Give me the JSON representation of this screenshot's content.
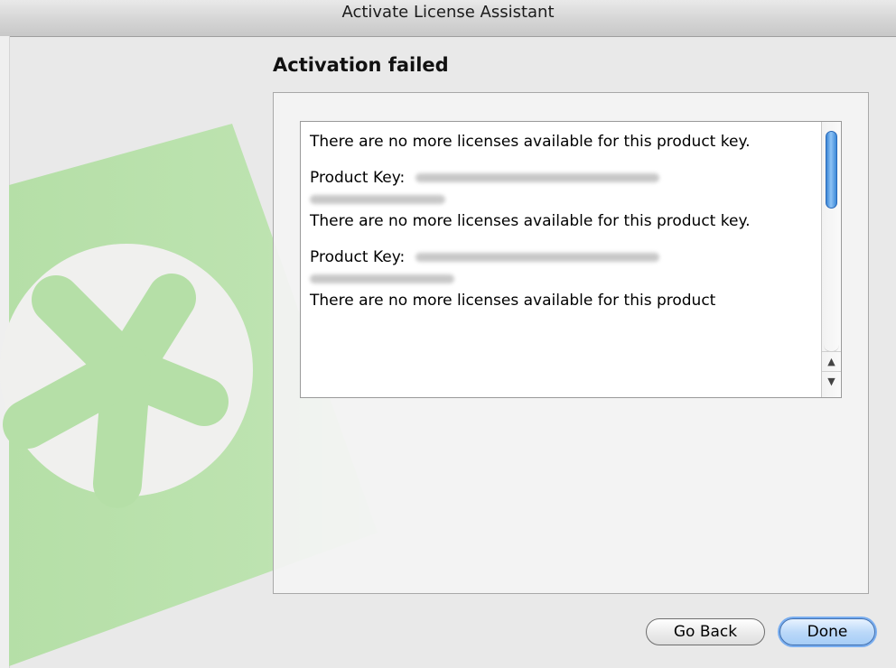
{
  "window": {
    "title": "Activate License Assistant"
  },
  "page": {
    "heading": "Activation failed"
  },
  "messages": {
    "line1": "There are no more licenses available for this product key.",
    "pk_label1": "Product Key:",
    "line2": "There are no more licenses available for this product key.",
    "pk_label2": "Product Key:",
    "line3": "There are no more licenses available for this product"
  },
  "scroll": {
    "up_arrow": "▲",
    "down_arrow": "▼"
  },
  "buttons": {
    "back": "Go Back",
    "done": "Done"
  },
  "colors": {
    "art_green": "#b7e0a9",
    "accent_blue": "#3b86d6"
  },
  "icons": {
    "logo": "green-asterisk-logo"
  }
}
